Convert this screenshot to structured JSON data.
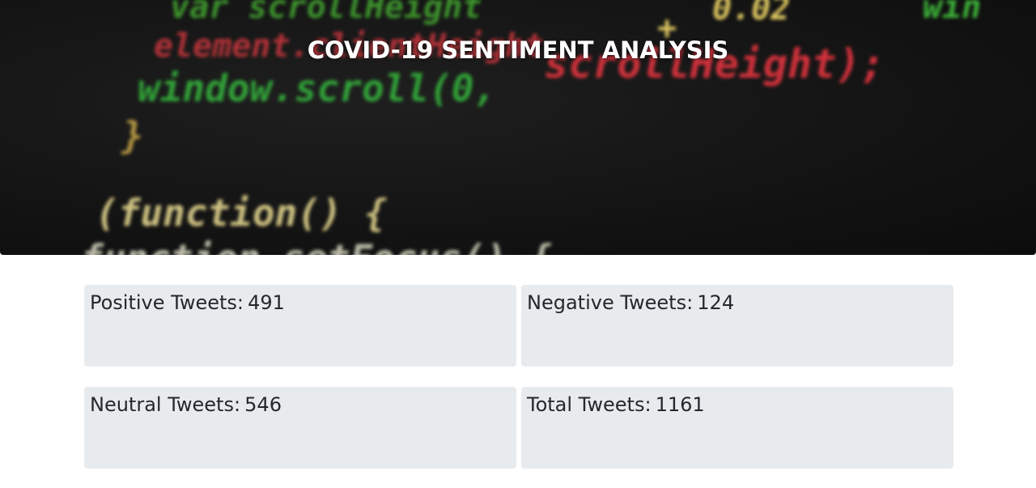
{
  "header": {
    "title": "COVID-19 SENTIMENT ANALYSIS"
  },
  "hero_image": {
    "description_icon": "code-background-image"
  },
  "stats": {
    "positive": {
      "label": "Positive Tweets:",
      "value": "491"
    },
    "negative": {
      "label": "Negative Tweets:",
      "value": "124"
    },
    "neutral": {
      "label": "Neutral Tweets:",
      "value": "546"
    },
    "total": {
      "label": "Total Tweets:",
      "value": "1161"
    }
  },
  "colors": {
    "card_background": "#e8ebee",
    "hero_background": "#141414",
    "title_text": "#ffffff",
    "card_text": "#24272b"
  }
}
